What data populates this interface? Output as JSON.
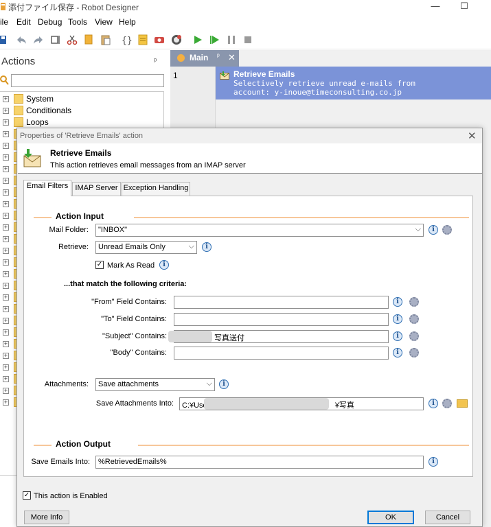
{
  "window": {
    "title": "添付ファイル保存 - Robot Designer",
    "minimize": "—",
    "maximize": "☐"
  },
  "menu": [
    "ile",
    "Edit",
    "Debug",
    "Tools",
    "View",
    "Help"
  ],
  "actions_panel": {
    "header": "Actions",
    "pin": "ᵖ",
    "search_placeholder": "",
    "tree": [
      "System",
      "Conditionals",
      "Loops"
    ]
  },
  "editor": {
    "tab_label": "Main",
    "tab_pin": "ᵖ",
    "tab_close": "✕",
    "line_number": "1",
    "action": {
      "title": "Retrieve Emails",
      "description": "Selectively retrieve unread e-mails from account: y-inoue@timeconsulting.co.jp"
    }
  },
  "dialog": {
    "title": "Properties of 'Retrieve Emails' action",
    "close": "✕",
    "header_title": "Retrieve Emails",
    "header_desc": "This action retrieves email messages from an IMAP server",
    "tabs": [
      "Email Filters",
      "IMAP Server",
      "Exception Handling"
    ],
    "active_tab": 0,
    "input_section": "Action Input",
    "mail_folder_label": "Mail Folder:",
    "mail_folder_value": "\"INBOX\"",
    "retrieve_label": "Retrieve:",
    "retrieve_value": "Unread Emails Only",
    "mark_as_read_label": "Mark As Read",
    "mark_as_read_checked": true,
    "criteria_heading": "...that match the following criteria:",
    "from_label": "\"From\" Field Contains:",
    "from_value": "",
    "to_label": "\"To\" Field Contains:",
    "to_value": "",
    "subject_label": "\"Subject\" Contains:",
    "subject_value": "写真送付",
    "body_label": "\"Body\" Contains:",
    "body_value": "",
    "attachments_label": "Attachments:",
    "attachments_value": "Save attachments",
    "save_into_label": "Save Attachments Into:",
    "save_into_prefix": "C:¥Use",
    "save_into_suffix": "¥写真",
    "output_section": "Action Output",
    "save_emails_label": "Save Emails Into:",
    "save_emails_value": "%RetrievedEmails%",
    "enabled_label": "This action is Enabled",
    "enabled_checked": true,
    "more_info": "More Info",
    "ok": "OK",
    "cancel": "Cancel"
  },
  "colors": {
    "accent_line": "#f7c79a",
    "selected_row": "#7b93d8",
    "tab_main": "#8a96ad",
    "default_button_border": "#0078d7"
  }
}
